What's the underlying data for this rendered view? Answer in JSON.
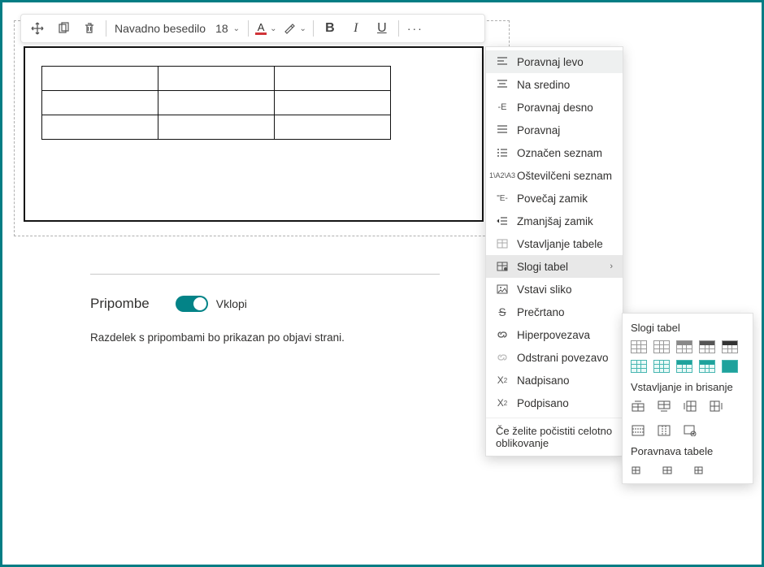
{
  "toolbar": {
    "style_label": "Navadno besedilo",
    "font_size": "18"
  },
  "comments": {
    "title": "Pripombe",
    "toggle_label": "Vklopi",
    "description": "Razdelek s pripombami bo prikazan po objavi strani."
  },
  "dropdown": {
    "items": [
      {
        "label": "Poravnaj levo",
        "icon": "align-left"
      },
      {
        "label": "Na sredino",
        "icon": "align-center"
      },
      {
        "label": "Poravnaj desno",
        "icon": "align-right"
      },
      {
        "label": "Poravnaj",
        "icon": "align-justify"
      },
      {
        "label": "Označen seznam",
        "icon": "bullet-list"
      },
      {
        "label": "Oštevilčeni seznam",
        "icon": "number-list"
      },
      {
        "label": "Povečaj zamik",
        "icon": "indent-more"
      },
      {
        "label": "Zmanjšaj zamik",
        "icon": "indent-less"
      },
      {
        "label": "Vstavljanje tabele",
        "icon": "insert-table"
      },
      {
        "label": "Slogi tabel",
        "icon": "table-styles",
        "submenu": true
      },
      {
        "label": "Vstavi sliko",
        "icon": "image"
      },
      {
        "label": "Prečrtano",
        "icon": "strike"
      },
      {
        "label": "Hiperpovezava",
        "icon": "link"
      },
      {
        "label": "Odstrani povezavo",
        "icon": "unlink"
      },
      {
        "label": "Nadpisano",
        "icon": "superscript"
      },
      {
        "label": "Podpisano",
        "icon": "subscript"
      }
    ],
    "footer": "Če želite počistiti celotno oblikovanje"
  },
  "submenu": {
    "styles_header": "Slogi tabel",
    "insert_delete_header": "Vstavljanje in brisanje",
    "align_header": "Poravnava tabele"
  }
}
